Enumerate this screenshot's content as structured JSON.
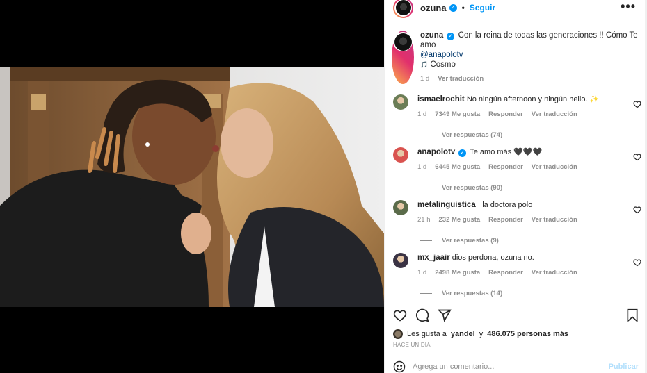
{
  "post": {
    "username": "ozuna",
    "follow_label": "Seguir",
    "more_label": "•••"
  },
  "caption": {
    "username": "ozuna",
    "text": "Con la reina de todas las generaciones !! Cómo Te amo",
    "mention": "@anapolotv",
    "music": "Cosmo",
    "music_icon": "🎵",
    "age": "1 d",
    "translate": "Ver traducción"
  },
  "comments": [
    {
      "username": "ismaelrochit",
      "verified": false,
      "text": "No ningún afternoon y ningún hello. ✨",
      "age": "1 d",
      "likes": "7349 Me gusta",
      "reply": "Responder",
      "translate": "Ver traducción",
      "replies": "Ver respuestas (74)",
      "avatar_color": "#6b7d56"
    },
    {
      "username": "anapolotv",
      "verified": true,
      "text": "Te amo más 🖤🖤🖤",
      "age": "1 d",
      "likes": "6445 Me gusta",
      "reply": "Responder",
      "translate": "Ver traducción",
      "replies": "Ver respuestas (90)",
      "avatar_color": "#d9534f"
    },
    {
      "username": "metalinguistica_",
      "verified": false,
      "text": "la doctora polo",
      "age": "21 h",
      "likes": "232 Me gusta",
      "reply": "Responder",
      "translate": "Ver traducción",
      "replies": "Ver respuestas (9)",
      "avatar_color": "#5a6b4a"
    },
    {
      "username": "mx_jaair",
      "verified": false,
      "text": "dios perdona, ozuna no.",
      "age": "1 d",
      "likes": "2498 Me gusta",
      "reply": "Responder",
      "translate": "Ver traducción",
      "replies": "Ver respuestas (14)",
      "avatar_color": "#3a3344"
    }
  ],
  "likes": {
    "prefix": "Les gusta a",
    "user": "yandel",
    "connector": "y",
    "count": "486.075 personas más"
  },
  "time_ago": "HACE UN DÍA",
  "add_comment": {
    "placeholder": "Agrega un comentario...",
    "publish": "Publicar"
  },
  "icons": {
    "like": "heart-icon",
    "comment": "comment-icon",
    "share": "share-icon",
    "save": "bookmark-icon",
    "emoji": "emoji-icon"
  },
  "colors": {
    "accent": "#0095f6",
    "muted": "#8e8e8e",
    "text": "#262626"
  }
}
